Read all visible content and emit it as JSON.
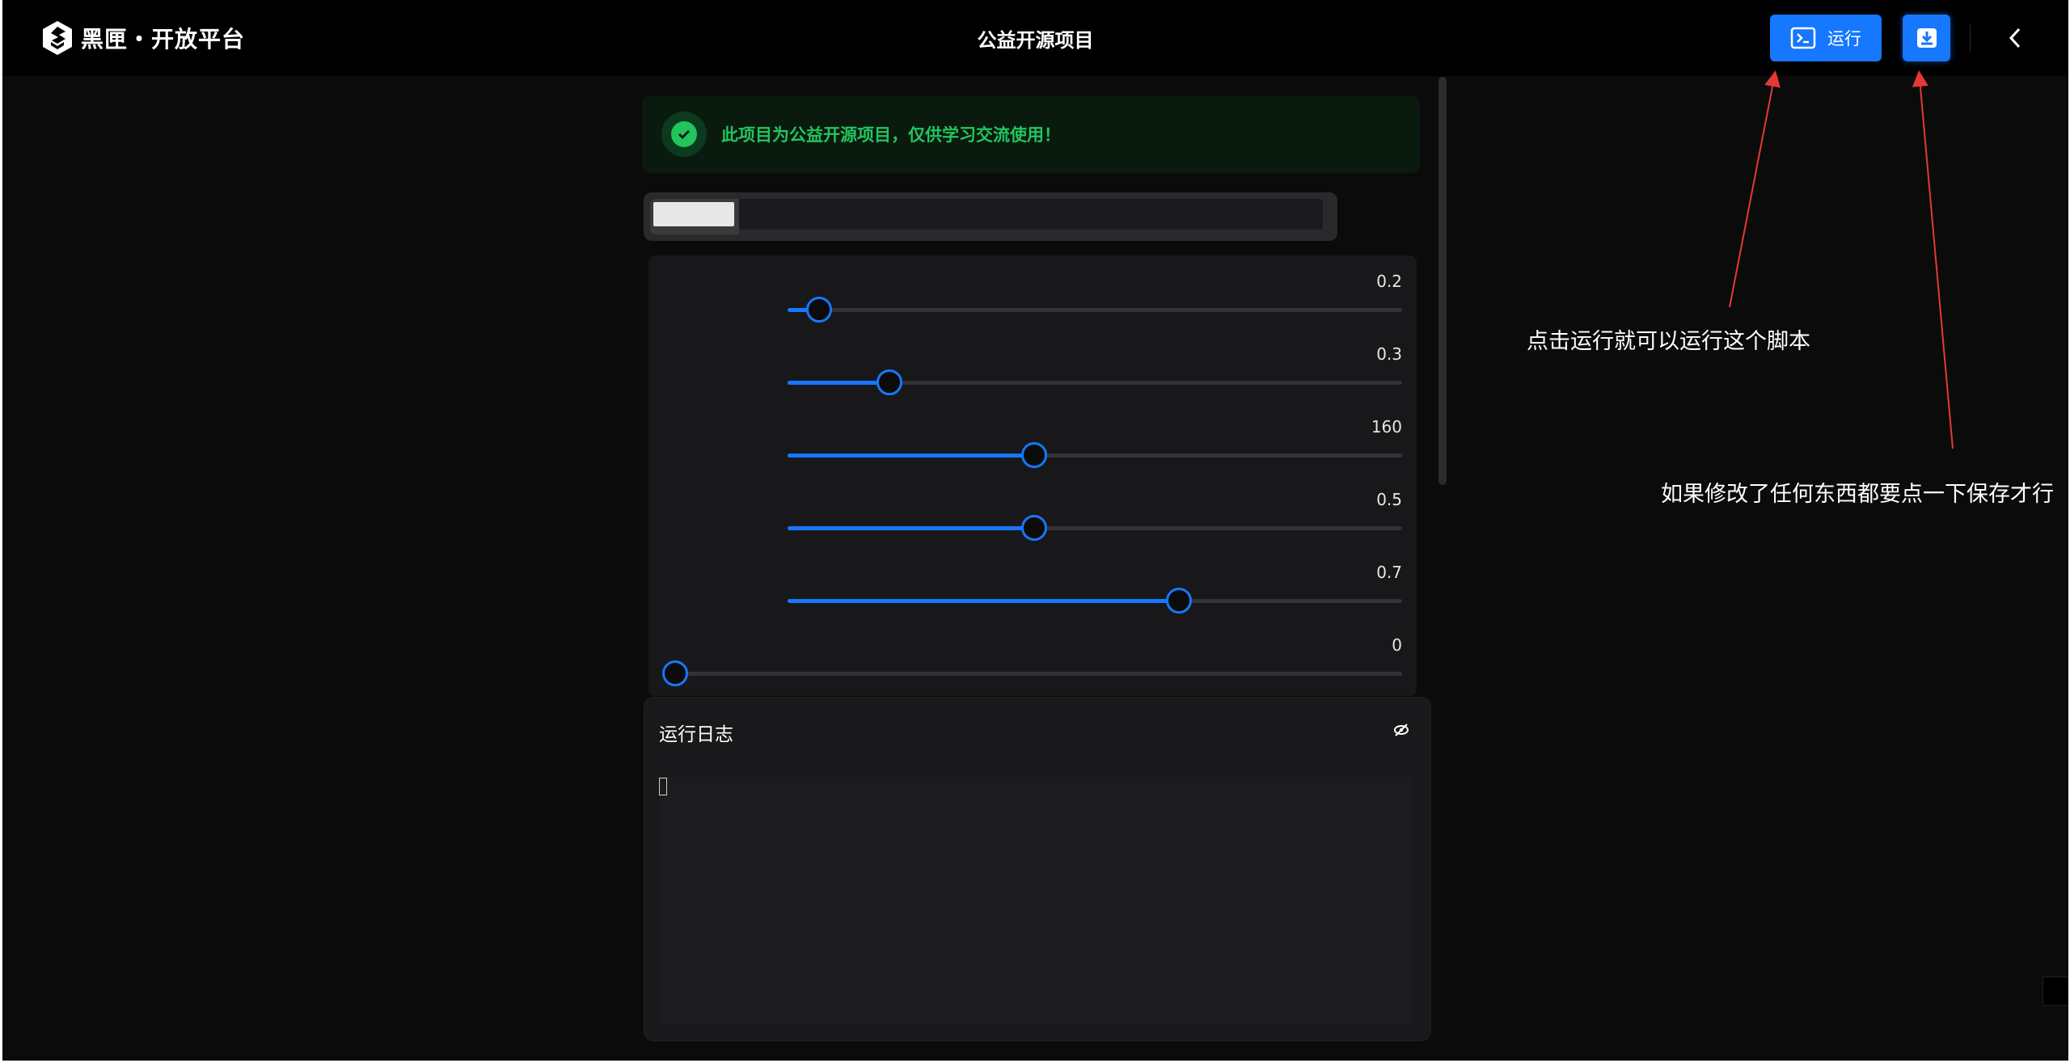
{
  "header": {
    "logo_text": "黑匣・开放平台",
    "title": "公益开源项目",
    "run_label": "运行"
  },
  "notice": {
    "text": "此项目为公益开源项目，仅供学习交流使用！"
  },
  "sliders": [
    {
      "value_label": "0.2",
      "fraction": 0.05
    },
    {
      "value_label": "0.3",
      "fraction": 0.165
    },
    {
      "value_label": "160",
      "fraction": 0.4
    },
    {
      "value_label": "0.5",
      "fraction": 0.4
    },
    {
      "value_label": "0.7",
      "fraction": 0.635
    },
    {
      "value_label": "0",
      "fraction": 0.0
    }
  ],
  "log": {
    "title": "运行日志"
  },
  "annotations": {
    "run_hint": "点击运行就可以运行这个脚本",
    "save_hint": "如果修改了任何东西都要点一下保存才行"
  },
  "colors": {
    "accent": "#1677ff",
    "success": "#22c55e",
    "arrow": "#e53935"
  },
  "icons": {
    "run": "terminal-icon",
    "save": "download-icon",
    "back": "chevron-left-icon",
    "notice": "check-circle-icon",
    "log_toggle": "eye-off-icon"
  }
}
